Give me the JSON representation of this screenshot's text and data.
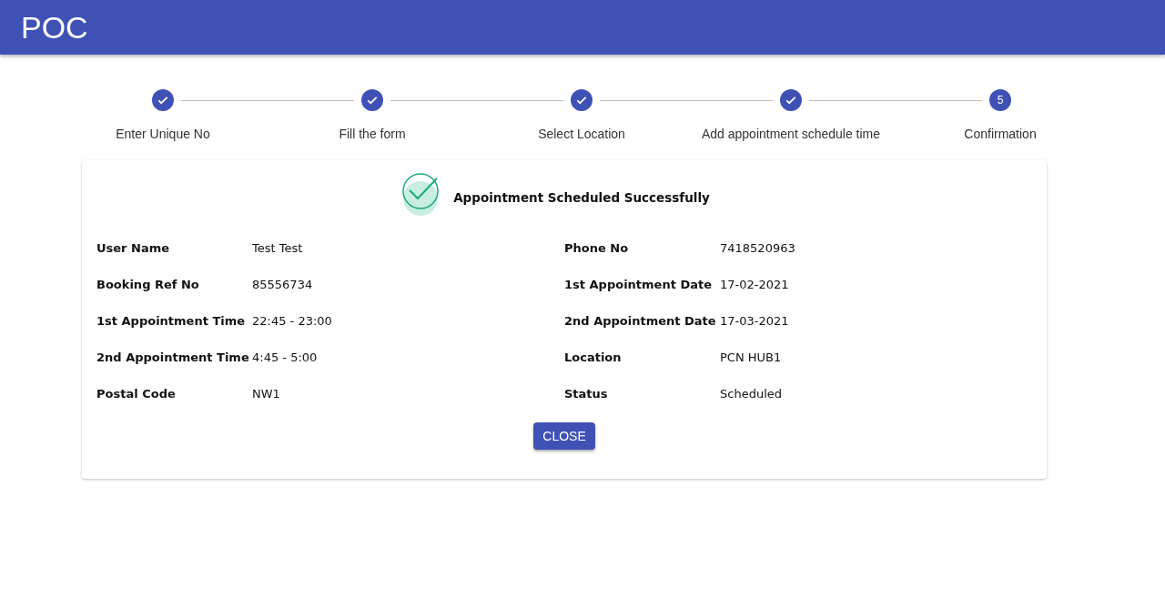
{
  "app_bar": {
    "title": "POC"
  },
  "steps": [
    {
      "label": "Enter Unique No",
      "completed": true
    },
    {
      "label": "Fill the form",
      "completed": true
    },
    {
      "label": "Select Location",
      "completed": true
    },
    {
      "label": "Add appointment schedule time",
      "completed": true
    },
    {
      "label": "Confirmation",
      "completed": false,
      "number": "5"
    }
  ],
  "confirmation": {
    "message": "Appointment Scheduled Successfully",
    "fields": [
      {
        "label": "User Name",
        "value": "Test Test"
      },
      {
        "label": "Phone No",
        "value": "7418520963"
      },
      {
        "label": "Booking Ref No",
        "value": "85556734"
      },
      {
        "label": "1st Appointment Date",
        "value": "17-02-2021"
      },
      {
        "label": "1st Appointment Time",
        "value": "22:45 - 23:00"
      },
      {
        "label": "2nd Appointment Date",
        "value": "17-03-2021"
      },
      {
        "label": "2nd Appointment Time",
        "value": "4:45 - 5:00"
      },
      {
        "label": "Location",
        "value": "PCN HUB1"
      },
      {
        "label": "Postal Code",
        "value": "NW1"
      },
      {
        "label": "Status",
        "value": "Scheduled"
      }
    ],
    "close_button": "CLOSE"
  }
}
